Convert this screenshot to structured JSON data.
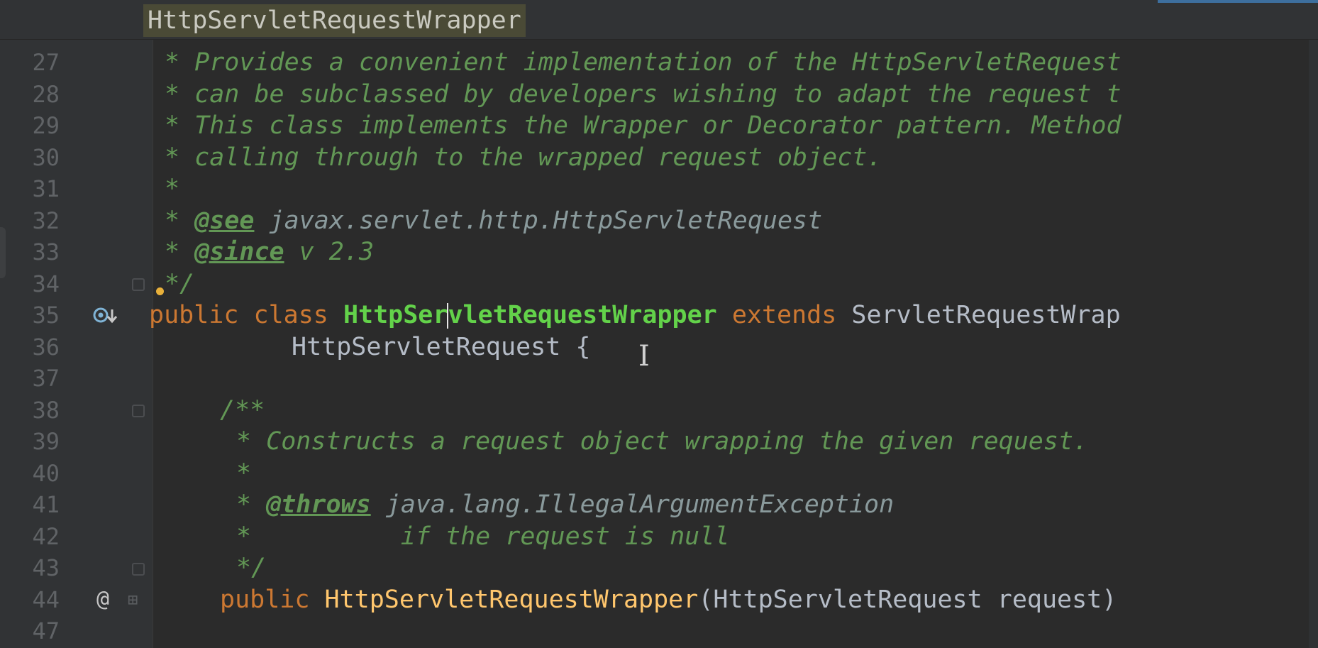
{
  "breadcrumb": "HttpServletRequestWrapper",
  "colors": {
    "background": "#2b2b2b",
    "gutter": "#313335",
    "comment": "#629755",
    "keyword": "#cc7832",
    "class_name": "#63d24a",
    "text": "#a9b7c6",
    "line_number": "#606366"
  },
  "lines": [
    {
      "num": "27",
      "t0": "* Provides a convenient implementation of the HttpServletRequest"
    },
    {
      "num": "28",
      "t0": "* can be subclassed by developers wishing to adapt the request t"
    },
    {
      "num": "29",
      "t0": "* This class implements the Wrapper or Decorator pattern. Method"
    },
    {
      "num": "30",
      "t0": "* calling through to the wrapped request object."
    },
    {
      "num": "31",
      "t0": "*"
    },
    {
      "num": "32",
      "t0": "* ",
      "tag": "@see",
      "t1": " ",
      "ref": "javax.servlet.http.HttpServletRequest"
    },
    {
      "num": "33",
      "t0": "* ",
      "tag": "@since",
      "t1": " v 2.3"
    },
    {
      "num": "34",
      "t0": "*/"
    },
    {
      "num": "35",
      "kw1": "public class ",
      "cls_a": "HttpSer",
      "cls_b": "vletRequestWrapper",
      "kw2": " extends ",
      "ty": "ServletRequestWrap"
    },
    {
      "num": "36",
      "t0": "HttpServletRequest {"
    },
    {
      "num": "37"
    },
    {
      "num": "38",
      "t0": "/**"
    },
    {
      "num": "39",
      "t0": "* Constructs a request object wrapping the given request."
    },
    {
      "num": "40",
      "t0": "*"
    },
    {
      "num": "41",
      "t0": "* ",
      "tag": "@throws",
      "t1": " ",
      "ref": "java.lang.IllegalArgumentException"
    },
    {
      "num": "42",
      "t0": "*",
      "t1": "          if the request is null"
    },
    {
      "num": "43",
      "t0": "*/"
    },
    {
      "num": "44",
      "kw1": "public ",
      "cls": "HttpServletRequestWrapper",
      "t0": "(HttpServletRequest request)"
    },
    {
      "num": "47"
    }
  ],
  "gutter_icons": {
    "line35": "implemented-overrides-icon",
    "line44": "annotation-at-icon",
    "line34": "intention-bulb-icon"
  }
}
